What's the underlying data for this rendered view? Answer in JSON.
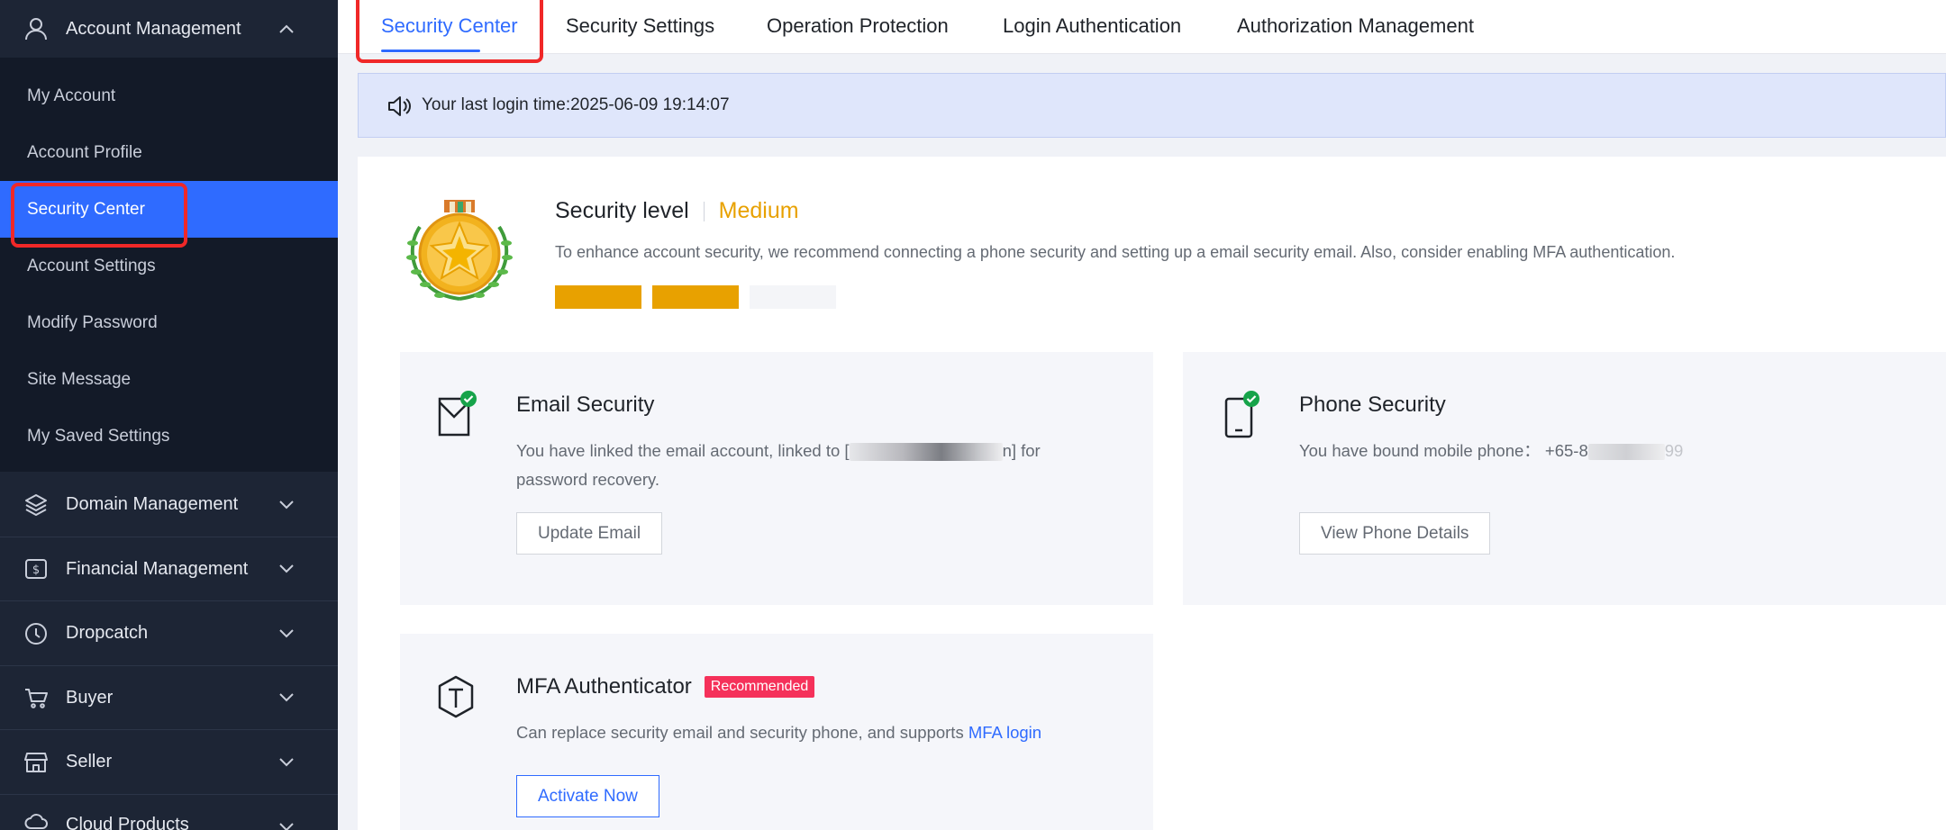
{
  "sidebar": {
    "account_group": "Account Management",
    "account_items": [
      "My Account",
      "Account Profile",
      "Security Center",
      "Account Settings",
      "Modify Password",
      "Site Message",
      "My Saved Settings"
    ],
    "groups": [
      "Domain Management",
      "Financial Management",
      "Dropcatch",
      "Buyer",
      "Seller",
      "Cloud Products"
    ],
    "active_item": "Security Center"
  },
  "tabs": [
    "Security Center",
    "Security Settings",
    "Operation Protection",
    "Login Authentication",
    "Authorization Management"
  ],
  "active_tab": "Security Center",
  "notice": {
    "text": "Your last login time:2025-06-09 19:14:07"
  },
  "security": {
    "title": "Security level",
    "level": "Medium",
    "description": "To enhance account security, we recommend connecting a phone security and setting up a email security email. Also, consider enabling MFA authentication.",
    "level_filled": 2,
    "level_total": 3,
    "level_color": "#e8a100"
  },
  "email": {
    "title": "Email Security",
    "desc_before": "You have linked the email account, linked to [",
    "desc_masked_tail": "n] for",
    "desc_line2": "password recovery.",
    "button": "Update Email"
  },
  "phone": {
    "title": "Phone Security",
    "desc": "You have bound mobile phone： +65-8",
    "desc_tail": "99",
    "button": "View Phone Details"
  },
  "mfa": {
    "title": "MFA Authenticator",
    "badge": "Recommended",
    "desc": "Can replace security email and security phone, and supports ",
    "link": "MFA login",
    "button": "Activate Now"
  },
  "colors": {
    "accent": "#2f6bff",
    "sidebar_bg": "#1d2535",
    "warning": "#e8a100",
    "badge": "#f5315a",
    "check": "#16a34a"
  }
}
